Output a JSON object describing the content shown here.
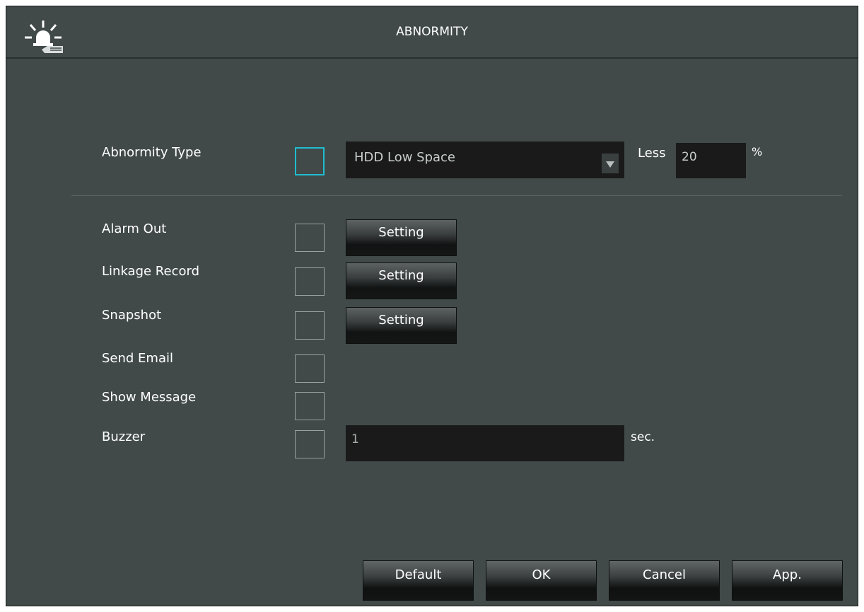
{
  "window": {
    "title": "ABNORMITY",
    "icon": "alarm-siren-icon"
  },
  "abnormity_type": {
    "label": "Abnormity Type",
    "enabled": false,
    "selected": "HDD Low Space",
    "less_label": "Less",
    "less_value": "20",
    "unit": "%"
  },
  "options": [
    {
      "label": "Alarm Out",
      "checked": false,
      "setting_label": "Setting"
    },
    {
      "label": "Linkage Record",
      "checked": false,
      "setting_label": "Setting"
    },
    {
      "label": "Snapshot",
      "checked": false,
      "setting_label": "Setting"
    },
    {
      "label": "Send Email",
      "checked": false
    },
    {
      "label": "Show Message",
      "checked": false
    },
    {
      "label": "Buzzer",
      "checked": false,
      "value": "1",
      "unit": "sec."
    }
  ],
  "buttons": {
    "default": "Default",
    "ok": "OK",
    "cancel": "Cancel",
    "apply": "App."
  },
  "colors": {
    "background": "#414a49",
    "field": "#1a1a1a",
    "focus_border": "#1fbcd0"
  }
}
